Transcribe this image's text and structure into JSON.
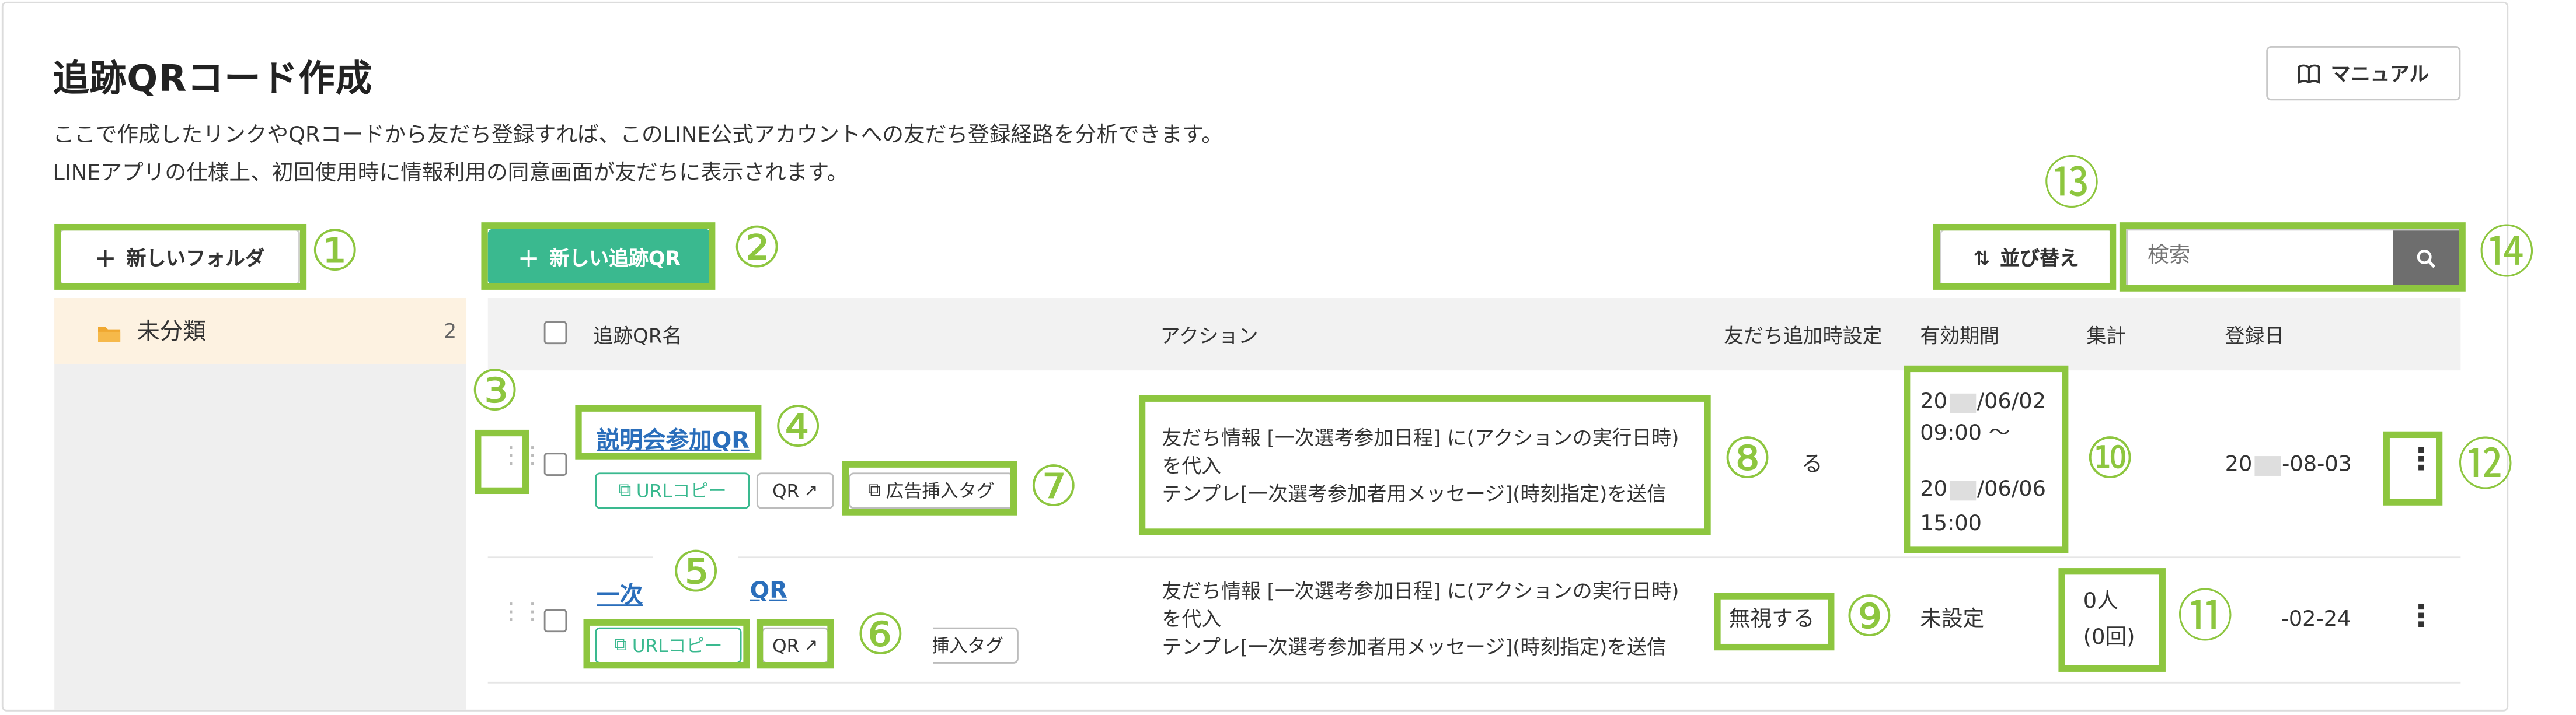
{
  "page": {
    "title": "追跡QRコード作成",
    "description_line1": "ここで作成したリンクやQRコードから友だち登録すれば、このLINE公式アカウントへの友だち登録経路を分析できます。",
    "description_line2": "LINEアプリの仕様上、初回使用時に情報利用の同意画面が友だちに表示されます。",
    "manual_label": "マニュアル"
  },
  "toolbar": {
    "new_folder_label": "新しいフォルダ",
    "new_qr_label": "新しい追跡QR",
    "sort_label": "並び替え",
    "search_placeholder": "検索"
  },
  "sidebar": {
    "folders": [
      {
        "label": "未分類",
        "count": "2"
      }
    ]
  },
  "table": {
    "headers": {
      "name": "追跡QR名",
      "action": "アクション",
      "friend_setting": "友だち追加時設定",
      "period": "有効期間",
      "total": "集計",
      "registered": "登録日"
    },
    "rows": [
      {
        "name": "説明会参加QR",
        "url_copy": "URLコピー",
        "qr": "QR",
        "ad_tag": "広告挿入タグ",
        "action_line1": "友だち情報 [一次選考参加日程] に(アクションの実行日時)",
        "action_line2": "を代入",
        "action_line3": "テンプレ[一次選考参加者用メッセージ](時刻指定)を送信",
        "friend_setting": "る",
        "period_start_prefix": "20",
        "period_start_suffix": "/06/02",
        "period_start_time": "09:00 〜",
        "period_end_prefix": "20",
        "period_end_suffix": "/06/06",
        "period_end_time": "15:00",
        "registered_prefix": "20",
        "registered_suffix": "-08-03"
      },
      {
        "name_part1": "一次",
        "name_part2": "QR",
        "url_copy": "URLコピー",
        "qr": "QR",
        "ad_tag_partial": "挿入タグ",
        "action_line1": "友だち情報 [一次選考参加日程] に(アクションの実行日時)",
        "action_line2": "を代入",
        "action_line3": "テンプレ[一次選考参加者用メッセージ](時刻指定)を送信",
        "friend_setting": "無視する",
        "period": "未設定",
        "total_line1": "0人",
        "total_line2": "(0回)",
        "registered_partial": "-02-24"
      }
    ]
  },
  "callouts": [
    "①",
    "②",
    "③",
    "④",
    "⑤",
    "⑥",
    "⑦",
    "⑧",
    "⑨",
    "⑩",
    "⑪",
    "⑫",
    "⑬",
    "⑭"
  ],
  "colors": {
    "accent_green": "#3ab98f",
    "highlight_green": "#8dc63f",
    "link_blue": "#2a6ebb",
    "folder_bg": "#fdf2e1"
  }
}
